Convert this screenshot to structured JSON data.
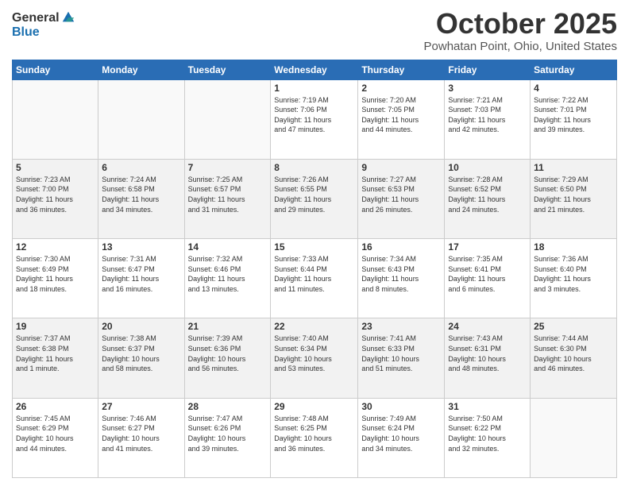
{
  "logo": {
    "general": "General",
    "blue": "Blue"
  },
  "title": "October 2025",
  "location": "Powhatan Point, Ohio, United States",
  "days_of_week": [
    "Sunday",
    "Monday",
    "Tuesday",
    "Wednesday",
    "Thursday",
    "Friday",
    "Saturday"
  ],
  "weeks": [
    [
      {
        "day": "",
        "info": ""
      },
      {
        "day": "",
        "info": ""
      },
      {
        "day": "",
        "info": ""
      },
      {
        "day": "1",
        "info": "Sunrise: 7:19 AM\nSunset: 7:06 PM\nDaylight: 11 hours\nand 47 minutes."
      },
      {
        "day": "2",
        "info": "Sunrise: 7:20 AM\nSunset: 7:05 PM\nDaylight: 11 hours\nand 44 minutes."
      },
      {
        "day": "3",
        "info": "Sunrise: 7:21 AM\nSunset: 7:03 PM\nDaylight: 11 hours\nand 42 minutes."
      },
      {
        "day": "4",
        "info": "Sunrise: 7:22 AM\nSunset: 7:01 PM\nDaylight: 11 hours\nand 39 minutes."
      }
    ],
    [
      {
        "day": "5",
        "info": "Sunrise: 7:23 AM\nSunset: 7:00 PM\nDaylight: 11 hours\nand 36 minutes."
      },
      {
        "day": "6",
        "info": "Sunrise: 7:24 AM\nSunset: 6:58 PM\nDaylight: 11 hours\nand 34 minutes."
      },
      {
        "day": "7",
        "info": "Sunrise: 7:25 AM\nSunset: 6:57 PM\nDaylight: 11 hours\nand 31 minutes."
      },
      {
        "day": "8",
        "info": "Sunrise: 7:26 AM\nSunset: 6:55 PM\nDaylight: 11 hours\nand 29 minutes."
      },
      {
        "day": "9",
        "info": "Sunrise: 7:27 AM\nSunset: 6:53 PM\nDaylight: 11 hours\nand 26 minutes."
      },
      {
        "day": "10",
        "info": "Sunrise: 7:28 AM\nSunset: 6:52 PM\nDaylight: 11 hours\nand 24 minutes."
      },
      {
        "day": "11",
        "info": "Sunrise: 7:29 AM\nSunset: 6:50 PM\nDaylight: 11 hours\nand 21 minutes."
      }
    ],
    [
      {
        "day": "12",
        "info": "Sunrise: 7:30 AM\nSunset: 6:49 PM\nDaylight: 11 hours\nand 18 minutes."
      },
      {
        "day": "13",
        "info": "Sunrise: 7:31 AM\nSunset: 6:47 PM\nDaylight: 11 hours\nand 16 minutes."
      },
      {
        "day": "14",
        "info": "Sunrise: 7:32 AM\nSunset: 6:46 PM\nDaylight: 11 hours\nand 13 minutes."
      },
      {
        "day": "15",
        "info": "Sunrise: 7:33 AM\nSunset: 6:44 PM\nDaylight: 11 hours\nand 11 minutes."
      },
      {
        "day": "16",
        "info": "Sunrise: 7:34 AM\nSunset: 6:43 PM\nDaylight: 11 hours\nand 8 minutes."
      },
      {
        "day": "17",
        "info": "Sunrise: 7:35 AM\nSunset: 6:41 PM\nDaylight: 11 hours\nand 6 minutes."
      },
      {
        "day": "18",
        "info": "Sunrise: 7:36 AM\nSunset: 6:40 PM\nDaylight: 11 hours\nand 3 minutes."
      }
    ],
    [
      {
        "day": "19",
        "info": "Sunrise: 7:37 AM\nSunset: 6:38 PM\nDaylight: 11 hours\nand 1 minute."
      },
      {
        "day": "20",
        "info": "Sunrise: 7:38 AM\nSunset: 6:37 PM\nDaylight: 10 hours\nand 58 minutes."
      },
      {
        "day": "21",
        "info": "Sunrise: 7:39 AM\nSunset: 6:36 PM\nDaylight: 10 hours\nand 56 minutes."
      },
      {
        "day": "22",
        "info": "Sunrise: 7:40 AM\nSunset: 6:34 PM\nDaylight: 10 hours\nand 53 minutes."
      },
      {
        "day": "23",
        "info": "Sunrise: 7:41 AM\nSunset: 6:33 PM\nDaylight: 10 hours\nand 51 minutes."
      },
      {
        "day": "24",
        "info": "Sunrise: 7:43 AM\nSunset: 6:31 PM\nDaylight: 10 hours\nand 48 minutes."
      },
      {
        "day": "25",
        "info": "Sunrise: 7:44 AM\nSunset: 6:30 PM\nDaylight: 10 hours\nand 46 minutes."
      }
    ],
    [
      {
        "day": "26",
        "info": "Sunrise: 7:45 AM\nSunset: 6:29 PM\nDaylight: 10 hours\nand 44 minutes."
      },
      {
        "day": "27",
        "info": "Sunrise: 7:46 AM\nSunset: 6:27 PM\nDaylight: 10 hours\nand 41 minutes."
      },
      {
        "day": "28",
        "info": "Sunrise: 7:47 AM\nSunset: 6:26 PM\nDaylight: 10 hours\nand 39 minutes."
      },
      {
        "day": "29",
        "info": "Sunrise: 7:48 AM\nSunset: 6:25 PM\nDaylight: 10 hours\nand 36 minutes."
      },
      {
        "day": "30",
        "info": "Sunrise: 7:49 AM\nSunset: 6:24 PM\nDaylight: 10 hours\nand 34 minutes."
      },
      {
        "day": "31",
        "info": "Sunrise: 7:50 AM\nSunset: 6:22 PM\nDaylight: 10 hours\nand 32 minutes."
      },
      {
        "day": "",
        "info": ""
      }
    ]
  ]
}
